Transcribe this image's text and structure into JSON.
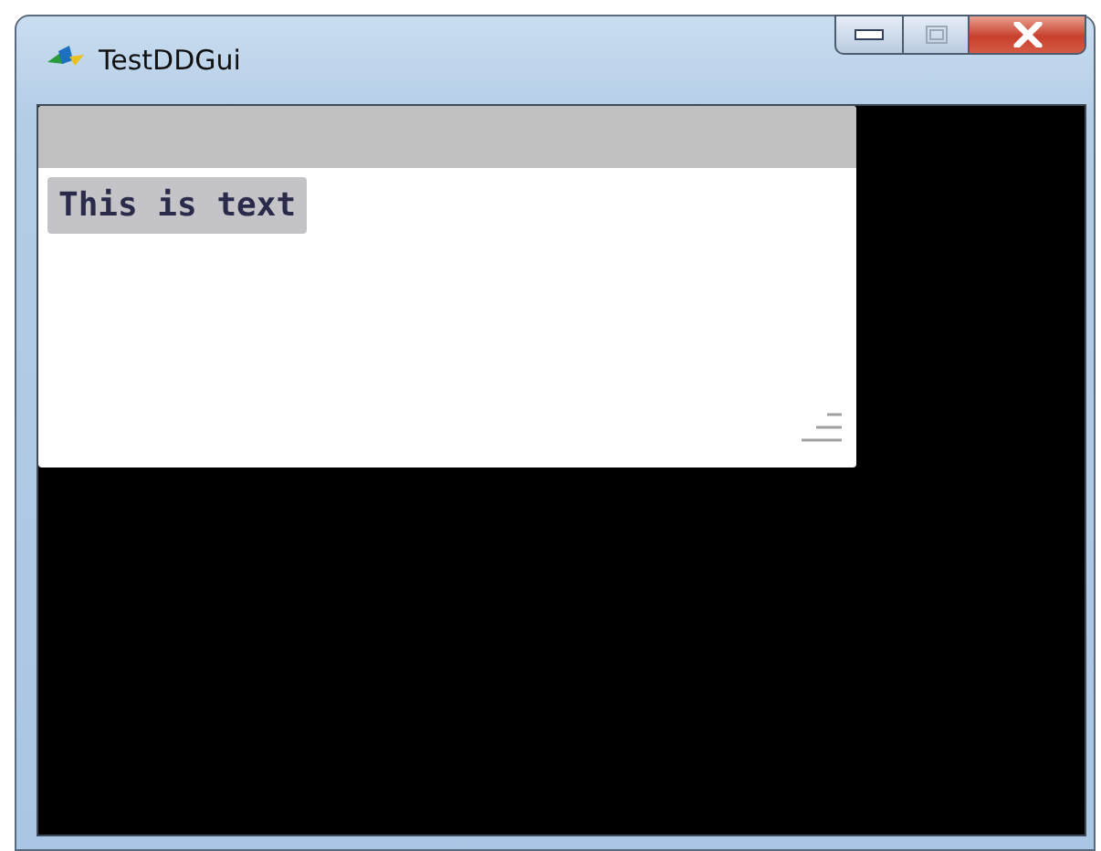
{
  "window": {
    "title": "TestDDGui"
  },
  "panel": {
    "label": "This is text"
  }
}
